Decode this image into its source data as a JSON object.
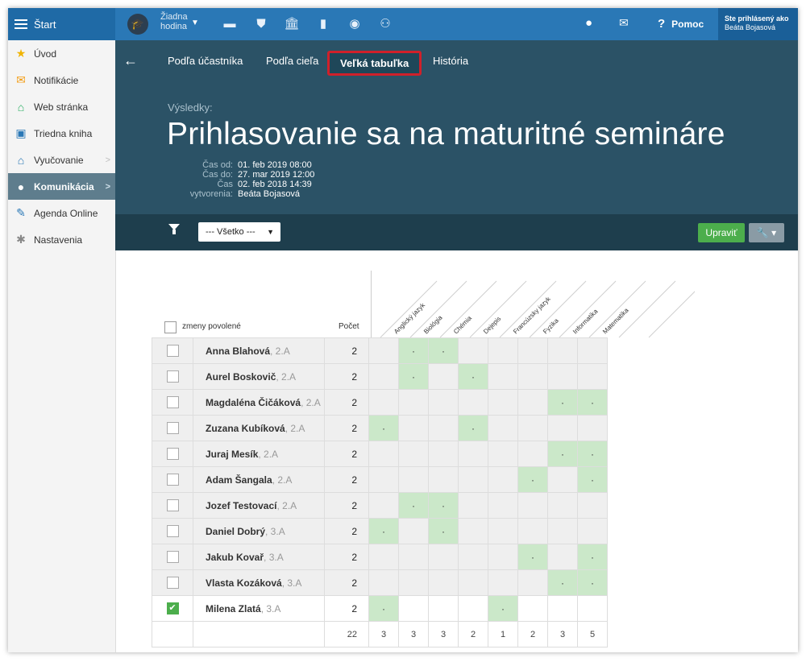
{
  "topbar": {
    "start_label": "Štart",
    "hodina_line1": "Žiadna",
    "hodina_line2": "hodina",
    "help_label": "Pomoc",
    "user_line1": "Ste prihlásený ako",
    "user_line2": "Beáta Bojasová",
    "accent": "#2a78b6"
  },
  "sidebar": {
    "items": [
      {
        "label": "Úvod",
        "icon": "star-icon",
        "glyph": "★",
        "color": "#f0b400"
      },
      {
        "label": "Notifikácie",
        "icon": "envelope-icon",
        "glyph": "✉",
        "color": "#f39c12"
      },
      {
        "label": "Web stránka",
        "icon": "home-icon",
        "glyph": "⌂",
        "color": "#27ae60"
      },
      {
        "label": "Triedna kniha",
        "icon": "book-icon",
        "glyph": "▣",
        "color": "#2a78b6"
      },
      {
        "label": "Vyučovanie",
        "icon": "school-icon",
        "glyph": "⌂",
        "color": "#2a78b6"
      },
      {
        "label": "Komunikácia",
        "icon": "chat-icon",
        "glyph": "●",
        "color": "#ffffff"
      },
      {
        "label": "Agenda Online",
        "icon": "pen-icon",
        "glyph": "✎",
        "color": "#2a78b6"
      },
      {
        "label": "Nastavenia",
        "icon": "gear-icon",
        "glyph": "✱",
        "color": "#888888"
      }
    ]
  },
  "tabs": [
    "Podľa účastníka",
    "Podľa cieľa",
    "Veľká tabuľka",
    "História"
  ],
  "header": {
    "results_label": "Výsledky:",
    "title": "Prihlasovanie sa na maturitné semináre",
    "meta": [
      {
        "k": "Čas od:",
        "v": "01. feb 2019 08:00"
      },
      {
        "k": "Čas do:",
        "v": "27. mar 2019 12:00"
      },
      {
        "k": "Čas",
        "v": "02. feb 2018 14:39"
      },
      {
        "k": "vytvorenia:",
        "v": "Beáta Bojasová"
      }
    ]
  },
  "filter": {
    "select_value": "--- Všetko ---",
    "edit_label": "Upraviť",
    "tools_label": "▾"
  },
  "table": {
    "select_all_label": "zmeny povolené",
    "count_label": "Počet",
    "subjects": [
      "Anglický jazyk",
      "Biológia",
      "Chémia",
      "Dejepis",
      "Francúzsky jazyk",
      "Fyzika",
      "Informatika",
      "Matematika"
    ],
    "rows": [
      {
        "name": "Anna Blahová",
        "cls": ", 2.A",
        "count": "2",
        "checked": false,
        "marks": [
          0,
          1,
          1,
          0,
          0,
          0,
          0,
          0
        ]
      },
      {
        "name": "Aurel Boskovič",
        "cls": ", 2.A",
        "count": "2",
        "checked": false,
        "marks": [
          0,
          1,
          0,
          1,
          0,
          0,
          0,
          0
        ]
      },
      {
        "name": "Magdaléna Čičáková",
        "cls": ", 2.A",
        "count": "2",
        "checked": false,
        "marks": [
          0,
          0,
          0,
          0,
          0,
          0,
          1,
          1
        ]
      },
      {
        "name": "Zuzana Kubíková",
        "cls": ", 2.A",
        "count": "2",
        "checked": false,
        "marks": [
          1,
          0,
          0,
          1,
          0,
          0,
          0,
          0
        ]
      },
      {
        "name": "Juraj Mesík",
        "cls": ", 2.A",
        "count": "2",
        "checked": false,
        "marks": [
          0,
          0,
          0,
          0,
          0,
          0,
          1,
          1
        ]
      },
      {
        "name": "Adam Šangala",
        "cls": ", 2.A",
        "count": "2",
        "checked": false,
        "marks": [
          0,
          0,
          0,
          0,
          0,
          1,
          0,
          1
        ]
      },
      {
        "name": "Jozef Testovací",
        "cls": ", 2.A",
        "count": "2",
        "checked": false,
        "marks": [
          0,
          1,
          1,
          0,
          0,
          0,
          0,
          0
        ]
      },
      {
        "name": "Daniel Dobrý",
        "cls": ", 3.A",
        "count": "2",
        "checked": false,
        "marks": [
          1,
          0,
          1,
          0,
          0,
          0,
          0,
          0
        ]
      },
      {
        "name": "Jakub Kovař",
        "cls": ", 3.A",
        "count": "2",
        "checked": false,
        "marks": [
          0,
          0,
          0,
          0,
          0,
          1,
          0,
          1
        ]
      },
      {
        "name": "Vlasta Kozáková",
        "cls": ", 3.A",
        "count": "2",
        "checked": false,
        "marks": [
          0,
          0,
          0,
          0,
          0,
          0,
          1,
          1
        ]
      },
      {
        "name": "Milena Zlatá",
        "cls": ", 3.A",
        "count": "2",
        "checked": true,
        "marks": [
          1,
          0,
          0,
          0,
          1,
          0,
          0,
          0
        ]
      }
    ],
    "mark_glyph": "·",
    "totals": {
      "count": "22",
      "subjects": [
        "3",
        "3",
        "3",
        "2",
        "1",
        "2",
        "3",
        "5"
      ]
    }
  }
}
